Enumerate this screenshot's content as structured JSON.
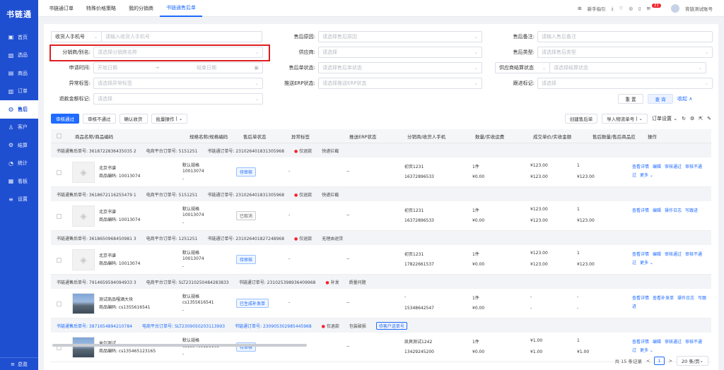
{
  "app": {
    "logo": "书链通",
    "footer": "总览"
  },
  "nav": [
    {
      "label": "首页",
      "icon": "▣"
    },
    {
      "label": "选品",
      "icon": "▧"
    },
    {
      "label": "商品",
      "icon": "▤"
    },
    {
      "label": "订单",
      "icon": "▥"
    },
    {
      "label": "售后",
      "icon": "◍"
    },
    {
      "label": "客户",
      "icon": "♙"
    },
    {
      "label": "结算",
      "icon": "⚙"
    },
    {
      "label": "统计",
      "icon": "◔"
    },
    {
      "label": "看板",
      "icon": "▦"
    },
    {
      "label": "设置",
      "icon": "≡"
    }
  ],
  "tabs": [
    "书链通订单",
    "特殊价格策略",
    "我的分销商",
    "书链通售后单"
  ],
  "topbar": {
    "guide": "新手指引",
    "badge": "21",
    "account": "背链测试账号"
  },
  "filters": {
    "buyer_phone_label": "收货人手机号",
    "buyer_phone_ph": "请输入收货人手机号",
    "reason_label": "售后原因:",
    "reason_ph": "请选择售后原因",
    "remark_label": "售后备注:",
    "remark_ph": "请输入售后备注",
    "distributor_label": "分销商/别名:",
    "distributor_ph": "请选择分销商名称",
    "supplier_label": "供应商:",
    "supplier_ph": "请选择",
    "type_label": "售后类型:",
    "type_ph": "请选择售后类型",
    "apply_time_label": "申请时间:",
    "start_ph": "开始日期",
    "end_ph": "结束日期",
    "order_status_label": "售后单状态:",
    "order_status_ph": "请选择售后单状态",
    "supplier_settle_label": "供应商结算状态",
    "supplier_settle_ph": "请选择结算状态",
    "abnormal_label": "异常标签:",
    "abnormal_ph": "请选择异常标签",
    "erp_label": "推送ERP状态:",
    "erp_ph": "请选择推送ERP状态",
    "follow_label": "跟进标记:",
    "follow_ph": "请选择",
    "refund_label": "退款金额标记:",
    "refund_ph": "请选择",
    "reset": "重 置",
    "query": "查 询",
    "collapse": "收起"
  },
  "toolbar": {
    "approve": "审核通过",
    "reject": "审核不通过",
    "confirm": "确认收货",
    "batch": "批量操作",
    "create": "创建售后单",
    "import": "导入物流单号",
    "export": "订单设置"
  },
  "columns": [
    "商品名称/商品编码",
    "规格名称/规格编码",
    "售后单状态",
    "异常标签",
    "推送ERP状态",
    "分销商/收货人手机",
    "数量/实收运费",
    "成交单价/实收金额",
    "售后数量/售后商品应",
    "操作"
  ],
  "groups": [
    {
      "line": "书链通售后单号: 3618722836435035 2",
      "mall": "电商平台订单号: 5151251",
      "order": "书链通订单号: 231026401831305968",
      "tag": "仅退款",
      "extra": "快递拦截",
      "name": "北京书谱",
      "code": "商品编码: 10013074",
      "spec": "默认规格",
      "spec_code": "10013074",
      "status": "待审核",
      "abn": "-",
      "erp": "--",
      "dist": "初页1231",
      "phone": "16372896533",
      "qty": "1件",
      "fee": "¥0.00",
      "price": "¥123.00",
      "paid": "¥123.00",
      "aqty": "1",
      "aamt": "¥123.00",
      "ops": [
        "查看详情",
        "编辑",
        "审核通过",
        "审核不通过",
        "更多"
      ]
    },
    {
      "line": "书链通售后单号: 3618672116255479 1",
      "mall": "电商平台订单号: 5151251",
      "order": "书链通订单号: 231026401831305968",
      "tag": "仅退款",
      "extra": "快递拦截",
      "name": "北京书谱",
      "code": "商品编码: 10013074",
      "spec": "默认规格",
      "spec_code": "10013074",
      "status": "已取消",
      "abn": "-",
      "erp": "--",
      "dist": "初页1231",
      "phone": "16372896533",
      "qty": "1件",
      "fee": "¥0.00",
      "price": "¥123.00",
      "paid": "¥123.00",
      "aqty": "1",
      "aamt": "¥123.00",
      "ops": [
        "查看详情",
        "编辑",
        "操作日志",
        "写跟进"
      ]
    },
    {
      "line": "书链通售后单号: 3618650968450981 3",
      "mall": "电商平台订单号: 1251251",
      "order": "书链通订单号: 231026401827248968",
      "tag": "仅退款",
      "extra": "无理由退货",
      "name": "北京书谱",
      "code": "商品编码: 10013074",
      "spec": "默认规格",
      "spec_code": "10013074",
      "status": "待审核",
      "abn": "-",
      "erp": "--",
      "dist": "初页1231",
      "phone": "17822661537",
      "qty": "1件",
      "fee": "¥0.00",
      "price": "¥123.00",
      "paid": "¥123.00",
      "aqty": "1",
      "aamt": "¥123.00",
      "ops": [
        "查看详情",
        "编辑",
        "审核通过",
        "审核不通过",
        "更多"
      ]
    },
    {
      "line": "书链通售后单号: 7914659594094933 3",
      "mall": "电商平台订单号: SLT2310250484283833",
      "order": "书链通订单号: 231025398936409968",
      "tag": "补发",
      "extra": "质量问题",
      "name": "测试商品嘎酒大块",
      "code": "商品编码: cs1355616541",
      "spec": "默认规格",
      "spec_code": "cs1355616541",
      "status": "已生成补发单",
      "abn": "-",
      "erp": "--",
      "dist": "-",
      "phone": "15348642547",
      "qty": "1件",
      "fee": "¥0.00",
      "price": "-",
      "paid": "-",
      "aqty": "-",
      "aamt": "-",
      "ops": [
        "查看详情",
        "查看补发单",
        "操作日志",
        "写跟进"
      ]
    },
    {
      "line": "书链通售后单号: 3871654894210784",
      "mall": "电商平台订单号: SLT2309050203113993",
      "order": "书链通订单号: 230905302985445968",
      "tag": "仅退款",
      "extra": "包装破损",
      "chip": "待客户送单号",
      "name": "米尔测试",
      "code": "商品编码: cs135465123165",
      "spec": "默认规格",
      "spec_code": "cs135465123165",
      "status": "待审核",
      "abn": "-",
      "erp": "--",
      "dist": "凯爽测试1242",
      "phone": "13429245200",
      "qty": "1件",
      "fee": "¥0.00",
      "price": "¥1.00",
      "paid": "¥1.00",
      "aqty": "1",
      "aamt": "¥1.00",
      "ops": [
        "查看详情",
        "编辑",
        "审核通过",
        "审核不通过",
        "更多"
      ]
    }
  ],
  "pager": {
    "total": "共 15 条记录",
    "page": "1",
    "size": "20 条/页"
  }
}
